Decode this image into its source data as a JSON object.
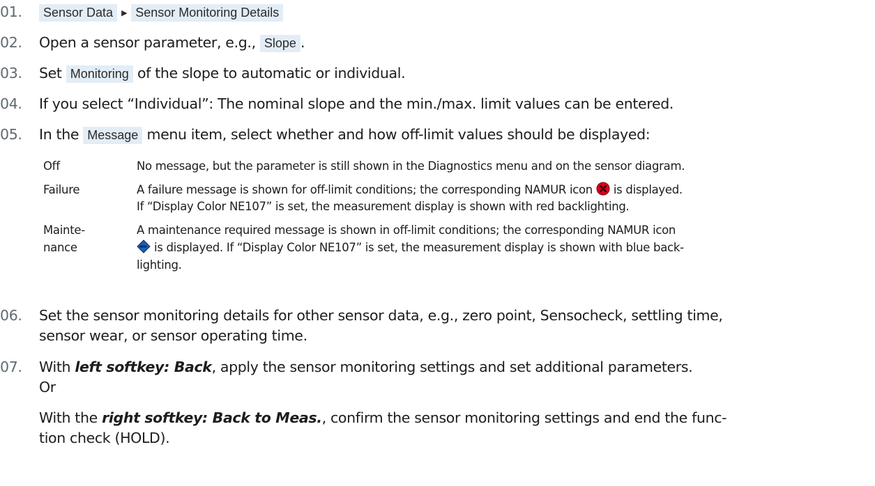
{
  "steps": [
    {
      "num": "01.",
      "chip1": "Sensor Data",
      "chip2": "Sensor Monitoring Details"
    },
    {
      "num": "02.",
      "pre": "Open a sensor parameter, e.g., ",
      "chip": "Slope",
      "post": "."
    },
    {
      "num": "03.",
      "pre": "Set ",
      "chip": "Monitoring",
      "post": " of the slope to automatic or individual."
    },
    {
      "num": "04.",
      "text": "If you select “Individual”: The nominal slope and the min./max. limit values can be entered."
    },
    {
      "num": "05.",
      "pre": "In the ",
      "chip": "Message",
      "post": " menu item, select whether and how off-limit values should be displayed:"
    },
    {
      "num": "06.",
      "line1": "Set the sensor monitoring details for other sensor data, e.g., zero point, Sensocheck, settling time,",
      "line2": "sensor wear, or sensor operating time."
    },
    {
      "num": "07.",
      "l1_pre": "With ",
      "l1_bold": "left softkey: Back",
      "l1_post": ", apply the sensor monitoring settings and set additional parameters.",
      "l2": "Or",
      "l3_pre": "With the ",
      "l3_bold": "right softkey: Back to Meas.",
      "l3_post": ", confirm the sensor monitoring settings and end the func-",
      "l4": "tion check (HOLD)."
    }
  ],
  "options": [
    {
      "term": "Off",
      "desc": [
        "No message, but the parameter is still shown in the Diagnostics menu and on the sensor diagram."
      ]
    },
    {
      "term": "Failure",
      "desc1_pre": "A failure message is shown for off-limit conditions; the corresponding NAMUR icon ",
      "desc1_post": " is displayed.",
      "desc2": "If “Display Color NE107” is set, the measurement display is shown with red backlighting.",
      "icon": "namur-failure-icon"
    },
    {
      "term1": "Mainte-",
      "term2": "nance",
      "desc1": "A maintenance required message is shown in off-limit conditions; the corresponding NAMUR icon",
      "desc2_post": " is displayed. If “Display Color NE107” is set, the measurement display is shown with blue back-",
      "desc3": "lighting.",
      "icon": "namur-maintenance-icon"
    }
  ],
  "colors": {
    "chip_bg": "#e3edf6",
    "failure_icon": "#e2001a",
    "maintenance_icon": "#1d5fb4"
  }
}
